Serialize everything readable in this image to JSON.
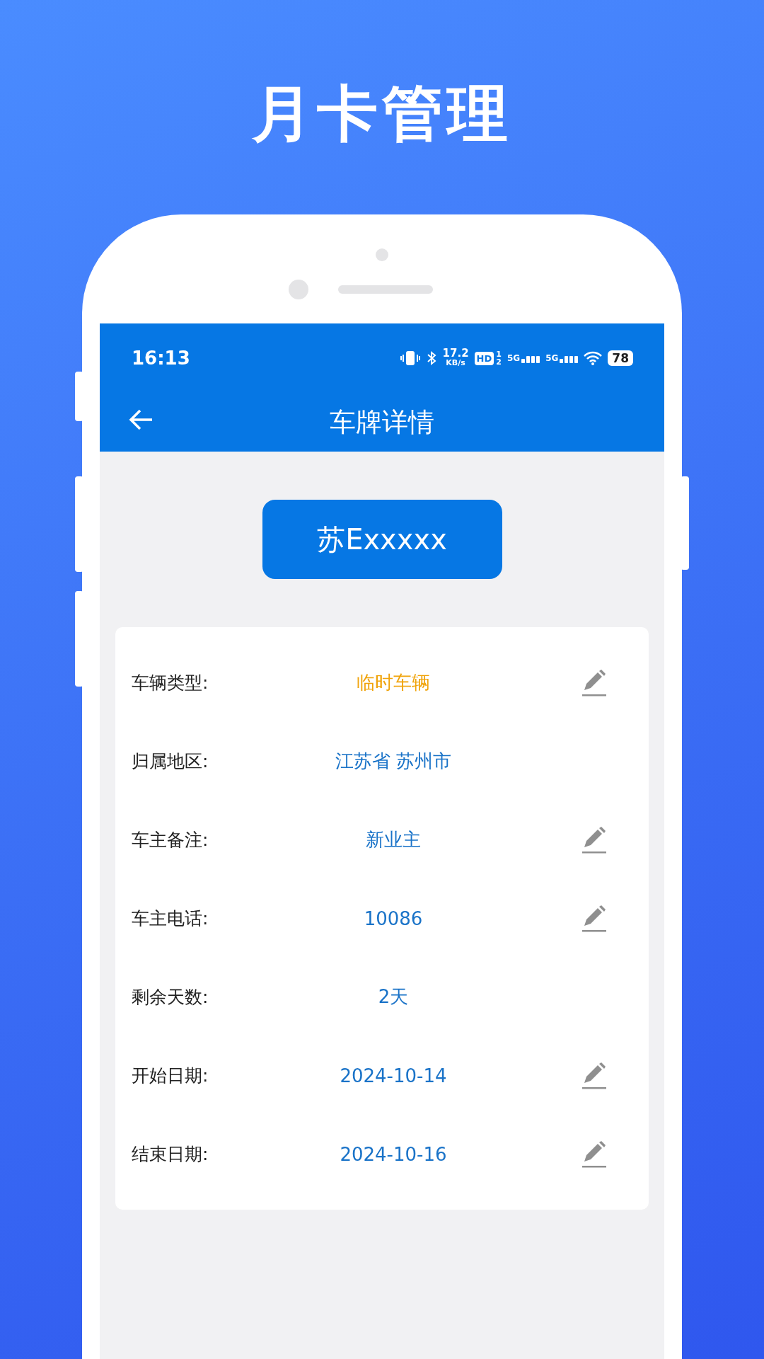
{
  "headline": "月卡管理",
  "status_bar": {
    "time": "16:13",
    "speed_value": "17.2",
    "speed_unit": "KB/s",
    "hd": "HD",
    "sim_1": "1",
    "sim_2": "2",
    "network_1": "5G",
    "network_2": "5G",
    "battery": "78"
  },
  "app_bar": {
    "title": "车牌详情"
  },
  "plate": "苏Exxxxx",
  "fields": [
    {
      "label": "车辆类型:",
      "value": "临时车辆",
      "color": "#f0a30a",
      "editable": true
    },
    {
      "label": "归属地区:",
      "value": "江苏省 苏州市",
      "color": "#1a73c8",
      "editable": false
    },
    {
      "label": "车主备注:",
      "value": "新业主",
      "color": "#1a73c8",
      "editable": true
    },
    {
      "label": "车主电话:",
      "value": "10086",
      "color": "#1a73c8",
      "editable": true
    },
    {
      "label": "剩余天数:",
      "value": "2天",
      "color": "#1a73c8",
      "editable": false
    },
    {
      "label": "开始日期:",
      "value": "2024-10-14",
      "color": "#1a73c8",
      "editable": true
    },
    {
      "label": "结束日期:",
      "value": "2024-10-16",
      "color": "#1a73c8",
      "editable": true
    }
  ]
}
